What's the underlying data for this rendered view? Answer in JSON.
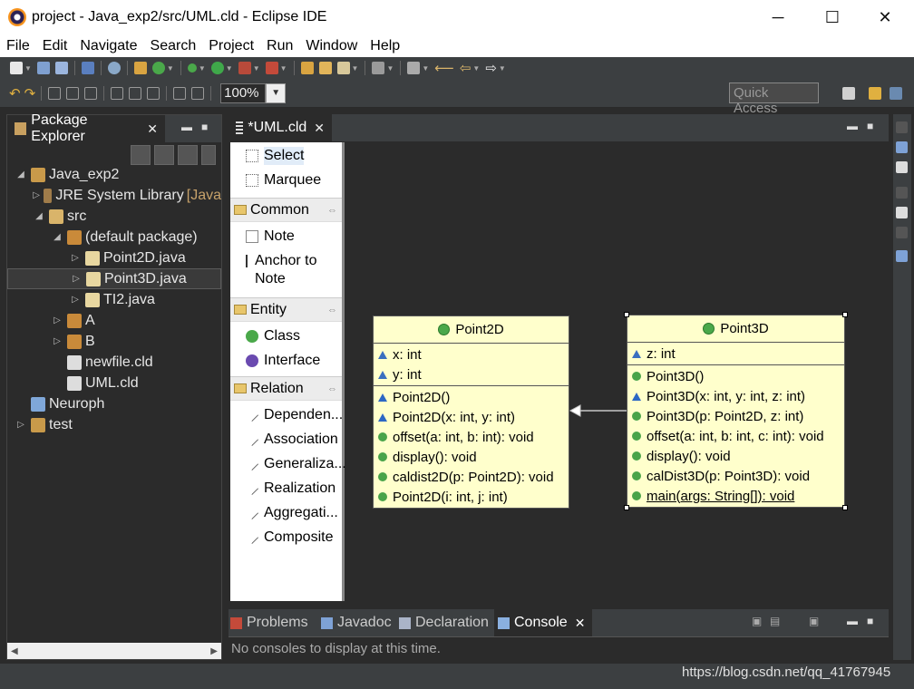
{
  "window": {
    "title": "project - Java_exp2/src/UML.cld - Eclipse IDE",
    "minimize": "─",
    "maximize": "☐",
    "close": "✕"
  },
  "menu": [
    "File",
    "Edit",
    "Navigate",
    "Search",
    "Project",
    "Run",
    "Window",
    "Help"
  ],
  "toolbar": {
    "zoom_value": "100%",
    "quick_access": "Quick Access"
  },
  "package_explorer": {
    "title": "Package Explorer",
    "tree": [
      {
        "label": "Java_exp2",
        "twisty": "◢",
        "icon": "project-icon",
        "color": "#c99a4a"
      },
      {
        "label": "JRE System Library",
        "decor": "[Java",
        "twisty": "▷",
        "icon": "library-icon",
        "color": "#a07c4a"
      },
      {
        "label": "src",
        "twisty": "◢",
        "icon": "source-folder-icon",
        "color": "#d9b46a"
      },
      {
        "label": "(default package)",
        "twisty": "◢",
        "icon": "package-icon",
        "color": "#c98a3a"
      },
      {
        "label": "Point2D.java",
        "twisty": "▷",
        "icon": "java-file-icon",
        "color": "#e8d7a0"
      },
      {
        "label": "Point3D.java",
        "twisty": "▷",
        "icon": "java-file-icon",
        "color": "#e8d7a0"
      },
      {
        "label": "TI2.java",
        "twisty": "▷",
        "icon": "java-file-icon",
        "color": "#e8d7a0"
      },
      {
        "label": "A",
        "twisty": "▷",
        "icon": "package-icon",
        "color": "#c98a3a"
      },
      {
        "label": "B",
        "twisty": "▷",
        "icon": "package-icon",
        "color": "#c98a3a"
      },
      {
        "label": "newfile.cld",
        "twisty": "",
        "icon": "cld-file-icon",
        "color": "#dddddd"
      },
      {
        "label": "UML.cld",
        "twisty": "",
        "icon": "cld-file-icon",
        "color": "#dddddd"
      },
      {
        "label": "Neuroph",
        "twisty": "",
        "icon": "closed-project-icon",
        "color": "#7fa7d9"
      },
      {
        "label": "test",
        "twisty": "▷",
        "icon": "project-icon",
        "color": "#c99a4a"
      }
    ]
  },
  "editor": {
    "tab_label": "*UML.cld",
    "palette": {
      "tools": [
        "Select",
        "Marquee"
      ],
      "drawers": [
        {
          "label": "Common",
          "items": [
            "Note",
            "Anchor to Note"
          ]
        },
        {
          "label": "Entity",
          "items": [
            "Class",
            "Interface"
          ]
        },
        {
          "label": "Relation",
          "items": [
            "Dependen...",
            "Association",
            "Generaliza...",
            "Realization",
            "Aggregati...",
            "Composite"
          ]
        }
      ]
    },
    "classes": [
      {
        "name": "Point2D",
        "fields": [
          "x: int",
          "y: int"
        ],
        "methods": [
          {
            "text": "Point2D()",
            "kind": "ctor"
          },
          {
            "text": "Point2D(x: int, y: int)",
            "kind": "ctor"
          },
          {
            "text": "offset(a: int, b: int): void",
            "kind": "method"
          },
          {
            "text": "display(): void",
            "kind": "method"
          },
          {
            "text": "caldist2D(p: Point2D): void",
            "kind": "method"
          },
          {
            "text": "Point2D(i: int, j: int)",
            "kind": "ctor-pub"
          }
        ]
      },
      {
        "name": "Point3D",
        "fields": [
          "z: int"
        ],
        "methods": [
          {
            "text": "Point3D()",
            "kind": "ctor-pub"
          },
          {
            "text": "Point3D(x: int, y: int, z: int)",
            "kind": "ctor"
          },
          {
            "text": "Point3D(p: Point2D, z: int)",
            "kind": "ctor-pub"
          },
          {
            "text": "offset(a: int, b: int, c: int): void",
            "kind": "method"
          },
          {
            "text": "display(): void",
            "kind": "method"
          },
          {
            "text": "calDist3D(p: Point3D): void",
            "kind": "method"
          },
          {
            "text": "main(args: String[]): void",
            "kind": "static"
          }
        ]
      }
    ]
  },
  "console": {
    "tabs": [
      "Problems",
      "Javadoc",
      "Declaration",
      "Console"
    ],
    "active_tab": "Console",
    "message": "No consoles to display at this time."
  },
  "watermark": "https://blog.csdn.net/qq_41767945"
}
